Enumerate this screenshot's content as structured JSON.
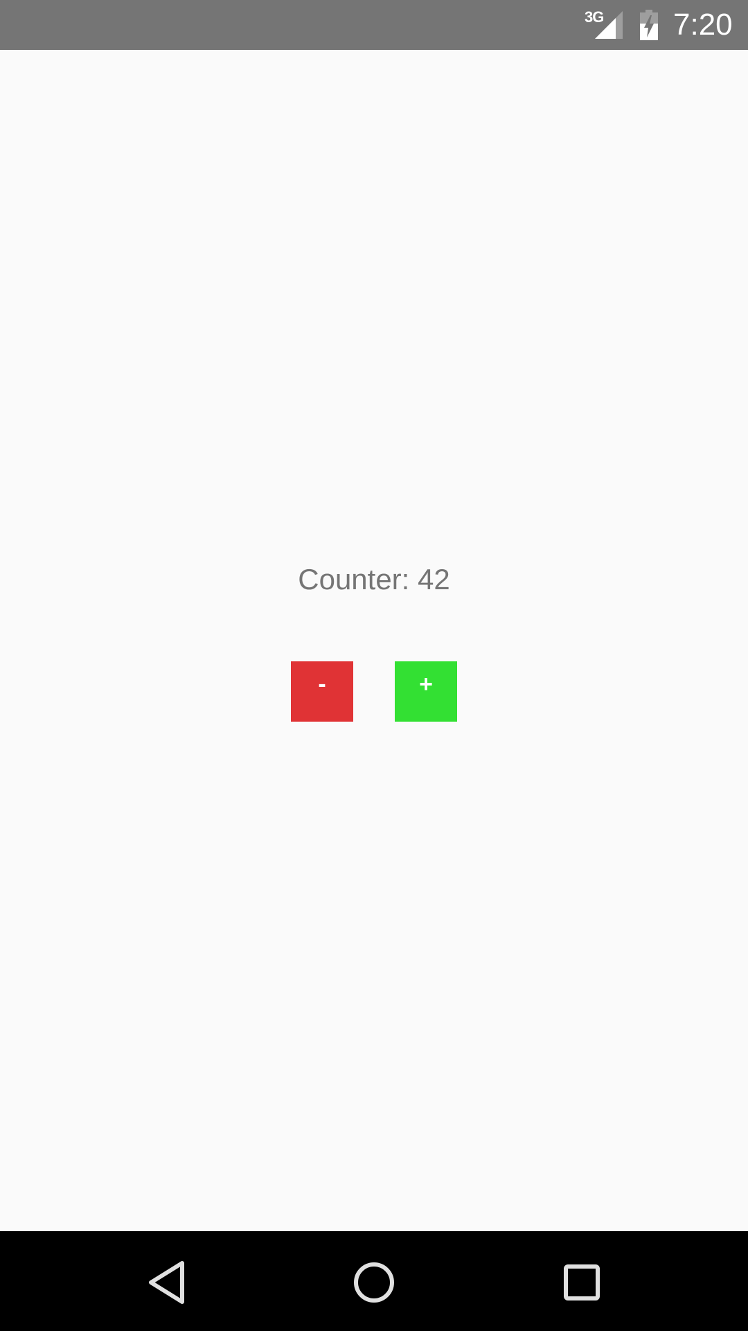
{
  "status_bar": {
    "network": "3G",
    "time": "7:20",
    "icons": [
      "signal-icon",
      "battery-charging-icon"
    ]
  },
  "main": {
    "counter_text": "Counter: 42",
    "decrement_label": "-",
    "increment_label": "+",
    "colors": {
      "decrement": "#e03335",
      "increment": "#33e033",
      "text": "#757575",
      "background": "#fafafa"
    }
  },
  "nav_bar": {
    "icons": [
      "back-icon",
      "home-icon",
      "recents-icon"
    ]
  }
}
